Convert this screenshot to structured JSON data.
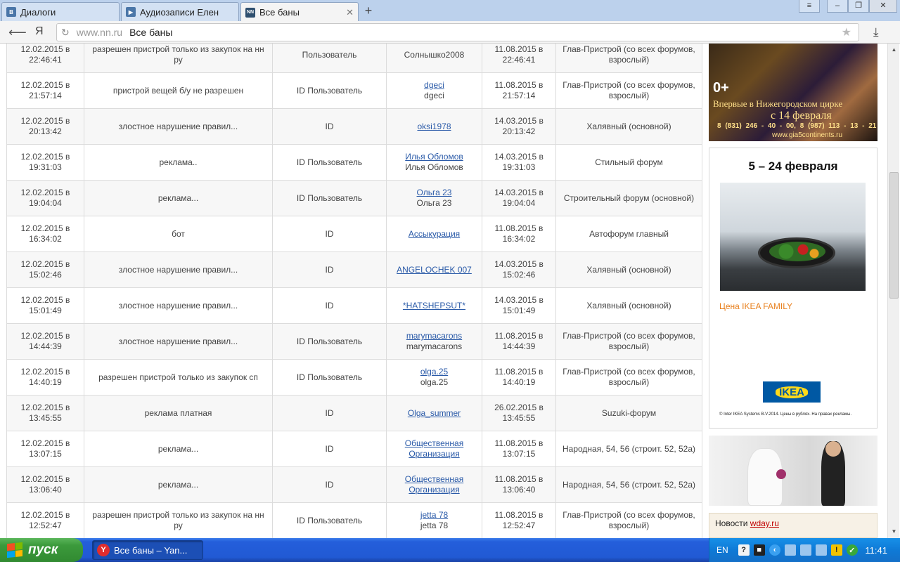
{
  "browser": {
    "tabs": [
      {
        "label": "Диалоги",
        "icon": "vk-icon"
      },
      {
        "label": "Аудиозаписи Елен",
        "icon": "vk-icon"
      },
      {
        "label": "Все баны",
        "icon": "nn-icon",
        "active": true
      }
    ],
    "new_tab": "+",
    "window_controls": [
      "≡",
      "‒",
      "❐",
      "✕"
    ],
    "address": {
      "host": "www.nn.ru",
      "title": "Все баны"
    }
  },
  "bans": {
    "rows": [
      {
        "date": "12.02.2015 в 22:46:41",
        "reason": "разрешен пристрой только из закупок на нн ру",
        "type": "Пользователь",
        "user_link": "",
        "user_text": "Солнышко2008",
        "until": "11.08.2015 в 22:46:41",
        "forum": "Глав-Пристрой (со всех форумов, взрослый)"
      },
      {
        "date": "12.02.2015 в 21:57:14",
        "reason": "пристрой вещей б/у не разрешен",
        "type": "ID Пользователь",
        "user_link": "dgeci",
        "user_text": "dgeci",
        "until": "11.08.2015 в 21:57:14",
        "forum": "Глав-Пристрой (со всех форумов, взрослый)"
      },
      {
        "date": "12.02.2015 в 20:13:42",
        "reason": "злостное нарушение правил...",
        "type": "ID",
        "user_link": "oksi1978",
        "user_text": "",
        "until": "14.03.2015 в 20:13:42",
        "forum": "Халявный (основной)"
      },
      {
        "date": "12.02.2015 в 19:31:03",
        "reason": "реклама..",
        "type": "ID Пользователь",
        "user_link": "Илья Обломов",
        "user_text": "Илья Обломов",
        "until": "14.03.2015 в 19:31:03",
        "forum": "Стильный форум"
      },
      {
        "date": "12.02.2015 в 19:04:04",
        "reason": "реклама...",
        "type": "ID Пользователь",
        "user_link": "Ольга 23",
        "user_text": "Ольга 23",
        "until": "14.03.2015 в 19:04:04",
        "forum": "Строительный форум (основной)"
      },
      {
        "date": "12.02.2015 в 16:34:02",
        "reason": "бот",
        "type": "ID",
        "user_link": "Ассыкурация",
        "user_text": "",
        "until": "11.08.2015 в 16:34:02",
        "forum": "Автофорум главный"
      },
      {
        "date": "12.02.2015 в 15:02:46",
        "reason": "злостное нарушение правил...",
        "type": "ID",
        "user_link": "ANGELOCHEK 007",
        "user_text": "",
        "until": "14.03.2015 в 15:02:46",
        "forum": "Халявный (основной)"
      },
      {
        "date": "12.02.2015 в 15:01:49",
        "reason": "злостное нарушение правил...",
        "type": "ID",
        "user_link": "*HATSHEPSUT*",
        "user_text": "",
        "until": "14.03.2015 в 15:01:49",
        "forum": "Халявный (основной)"
      },
      {
        "date": "12.02.2015 в 14:44:39",
        "reason": "злостное нарушение правил...",
        "type": "ID Пользователь",
        "user_link": "marymacarons",
        "user_text": "marymacarons",
        "until": "11.08.2015 в 14:44:39",
        "forum": "Глав-Пристрой (со всех форумов, взрослый)"
      },
      {
        "date": "12.02.2015 в 14:40:19",
        "reason": "разрешен пристрой только из закупок сп",
        "type": "ID Пользователь",
        "user_link": "olga.25",
        "user_text": "olga.25",
        "until": "11.08.2015 в 14:40:19",
        "forum": "Глав-Пристрой (со всех форумов, взрослый)"
      },
      {
        "date": "12.02.2015 в 13:45:55",
        "reason": "реклама платная",
        "type": "ID",
        "user_link": "Olga_summer",
        "user_text": "",
        "until": "26.02.2015 в 13:45:55",
        "forum": "Suzuki-форум"
      },
      {
        "date": "12.02.2015 в 13:07:15",
        "reason": "реклама...",
        "type": "ID",
        "user_link": "Общественная Организация",
        "user_text": "",
        "until": "11.08.2015 в 13:07:15",
        "forum": "Народная, 54, 56 (строит. 52, 52а)"
      },
      {
        "date": "12.02.2015 в 13:06:40",
        "reason": "реклама...",
        "type": "ID",
        "user_link": "Общественная Организация",
        "user_text": "",
        "until": "11.08.2015 в 13:06:40",
        "forum": "Народная, 54, 56 (строит. 52, 52а)"
      },
      {
        "date": "12.02.2015 в 12:52:47",
        "reason": "разрешен пристрой только из закупок на нн ру",
        "type": "ID Пользователь",
        "user_link": "jetta 78",
        "user_text": "jetta 78",
        "until": "11.08.2015 в 12:52:47",
        "forum": "Глав-Пристрой (со всех форумов, взрослый)"
      }
    ]
  },
  "ads": {
    "circus": {
      "age": "0+",
      "line1": "Впервые в Нижегородском цирке",
      "line2": "с 14 февраля",
      "phones": "8 (831) 246 - 40 - 00, 8 (987) 113 - 13 - 21",
      "site": "www.gia5continents.ru"
    },
    "ikea": {
      "dates": "5 – 24 февраля",
      "price_text": "Цена IKEA FAMILY",
      "logo": "IKEA",
      "legal": "© Inter IKEA Systems B.V.2014. Цены в рублях. На правах рекламы."
    },
    "news": {
      "label": "Новости",
      "link": "wday.ru"
    }
  },
  "taskbar": {
    "start": "пуск",
    "task": "Все баны – Yan...",
    "lang": "EN",
    "clock": "11:41"
  }
}
